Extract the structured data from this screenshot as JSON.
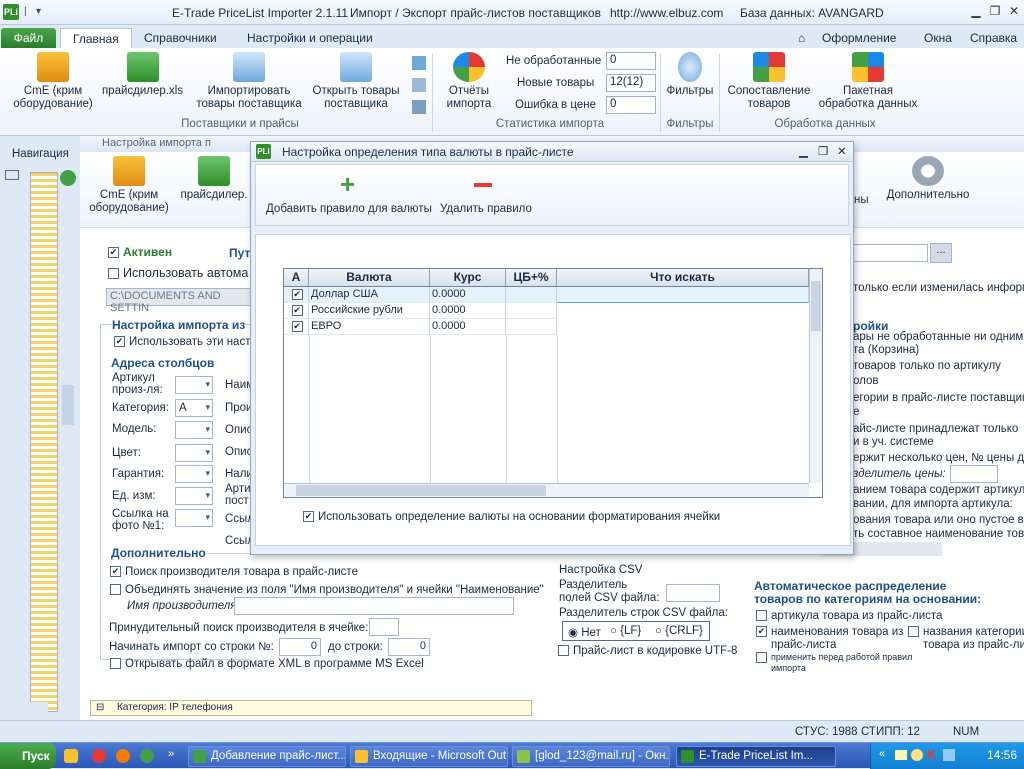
{
  "title": {
    "app": "E-Trade PriceList Importer 2.1.11",
    "subtitle": "Импорт / Экспорт прайс-листов поставщиков",
    "url": "http://www.elbuz.com",
    "db": "База данных: AVANGARD",
    "icon": "PLi"
  },
  "tabs": {
    "file": "Файл",
    "main": "Главная",
    "refs": "Справочники",
    "settings": "Настройки и операции",
    "theme": "Оформление",
    "window": "Окна",
    "help": "Справка"
  },
  "ribbon": {
    "b1": "СmE (крим",
    "b1b": "оборудование)",
    "b2": "прайсдилер.xls",
    "b3": "Импортировать",
    "b3b": "товары поставщика",
    "b4": "Открыть товары",
    "b4b": "поставщика",
    "g1": "Поставщики и прайсы",
    "s1": "Не обработанные",
    "v1": "0",
    "s2": "Новые товары",
    "v2": "12(12)",
    "s3": "Ошибка в цене",
    "v3": "0",
    "b5": "Отчёты",
    "b5b": "импорта",
    "g2": "Статистика импорта",
    "b6": "Фильтры",
    "g3": "Фильтры",
    "b7": "Сопоставление",
    "b7b": "товаров",
    "b8": "Пакетная",
    "b8b": "обработка данных",
    "g4": "Обработка данных"
  },
  "nav": {
    "label": "Навигация"
  },
  "child": {
    "title": "Настройка импорта п",
    "b1": "СmE (крим",
    "b1b": "оборудование)",
    "b2": "прайсдилер.",
    "b3": "ны",
    "b4": "Дополнительно"
  },
  "form": {
    "active": "Активен",
    "path": "Пут",
    "useauto": "Использовать автома",
    "pathval": "C:\\DOCUMENTS AND SETTIN",
    "importset": "Настройка импорта из",
    "usethese": "Использовать эти настр",
    "colhead": "Адреса столбцов",
    "manuf": "Артикул",
    "manufb": "произ-ля:",
    "cat": "Категория:",
    "catval": "А",
    "model": "Модель:",
    "color": "Цвет:",
    "warranty": "Гарантия:",
    "unit": "Ед. изм:",
    "photo": "Ссылка на",
    "photob": "фото №1:",
    "n1": "Наим",
    "n2": "Прои",
    "n3": "Опис",
    "n4": "Опис",
    "n5": "Нали",
    "n6": "Арти",
    "n6b": "пост",
    "n7": "Ссыл",
    "n8": "Ссыл",
    "extra": "Дополнительно",
    "find": "Поиск производителя товара в прайс-листе",
    "combine": "Объединять значение из поля \"Имя производителя\" и ячейки \"Наименование\"",
    "mname": "Имя производителя:",
    "forced": "Принудительный поиск производителя в ячейке:",
    "startrow": "Начинать импорт со строки №:",
    "startval": "0",
    "torow": "до строки:",
    "toval": "0",
    "xml": "Открывать файл в формате XML в программе MS Excel",
    "csv": "Настройка CSV",
    "csvsep": "Разделитель",
    "csvsep2": "полей CSV файла:",
    "rowsep": "Разделитель строк CSV файла:",
    "no": "Нет",
    "lf": "{LF}",
    "crlf": "{CRLF}",
    "utf": "Прайс-лист в кодировке UTF-8"
  },
  "right": {
    "r1": "только если изменилась информа",
    "r2": "ройки",
    "r3": "ары не обработанные ни одним",
    "r4": "та (Корзина)",
    "r5": "товаров только по артикулу",
    "r6": "олов",
    "r7": "егории в прайс-листе поставщик",
    "r8": "е",
    "r9": "айс-листе принадлежат только",
    "r10": "и в уч. системе",
    "r11": "ержит несколько цен, № цены д",
    "r12": "зделитель цены:",
    "r13": "анием товара содержит артикул,",
    "r14": "вании, для импорта артикула:",
    "r15": "ования товара или оно пустое в",
    "r16": "ть составное наименование товар",
    "auto": "Автоматическое распределение",
    "auto2": "товаров по категориям на основании:",
    "a1": "артикула товара из прайс-листа",
    "a2": "наименования товара из",
    "a2b": "прайс-листа",
    "a3": "названия  категории",
    "a3b": "товара из прайс-ли",
    "a4": "применить перед работой правил",
    "a4b": "импорта",
    "dots": "..."
  },
  "dialog": {
    "title": "Настройка определения типа валюты в прайс-листе",
    "add": "Добавить правило для валюты",
    "del": "Удалить правило",
    "usefmt": "Использовать определение валюты на основании форматирования ячейки"
  },
  "grid": {
    "headers": [
      "А",
      "Валюта",
      "Курс",
      "ЦБ+%",
      "Что искать"
    ],
    "rows": [
      {
        "name": "Доллар США",
        "rate": "0.0000"
      },
      {
        "name": "Российские рубли",
        "rate": "0.0000"
      },
      {
        "name": "ЕВРО",
        "rate": "0.0000"
      }
    ]
  },
  "catbar": "Категория: IP телефония",
  "status": {
    "s1": "СТУС: 1988",
    "s2": "СТИПП: 12",
    "s3": "NUM"
  },
  "taskbar": {
    "start": "Пуск",
    "t1": "Добавление прайс-лист...",
    "t2": "Входящие - Microsoft Out...",
    "t3": "[glod_123@mail.ru] - Окн...",
    "t4": "E-Trade PriceList Im...",
    "clock": "14:56"
  }
}
